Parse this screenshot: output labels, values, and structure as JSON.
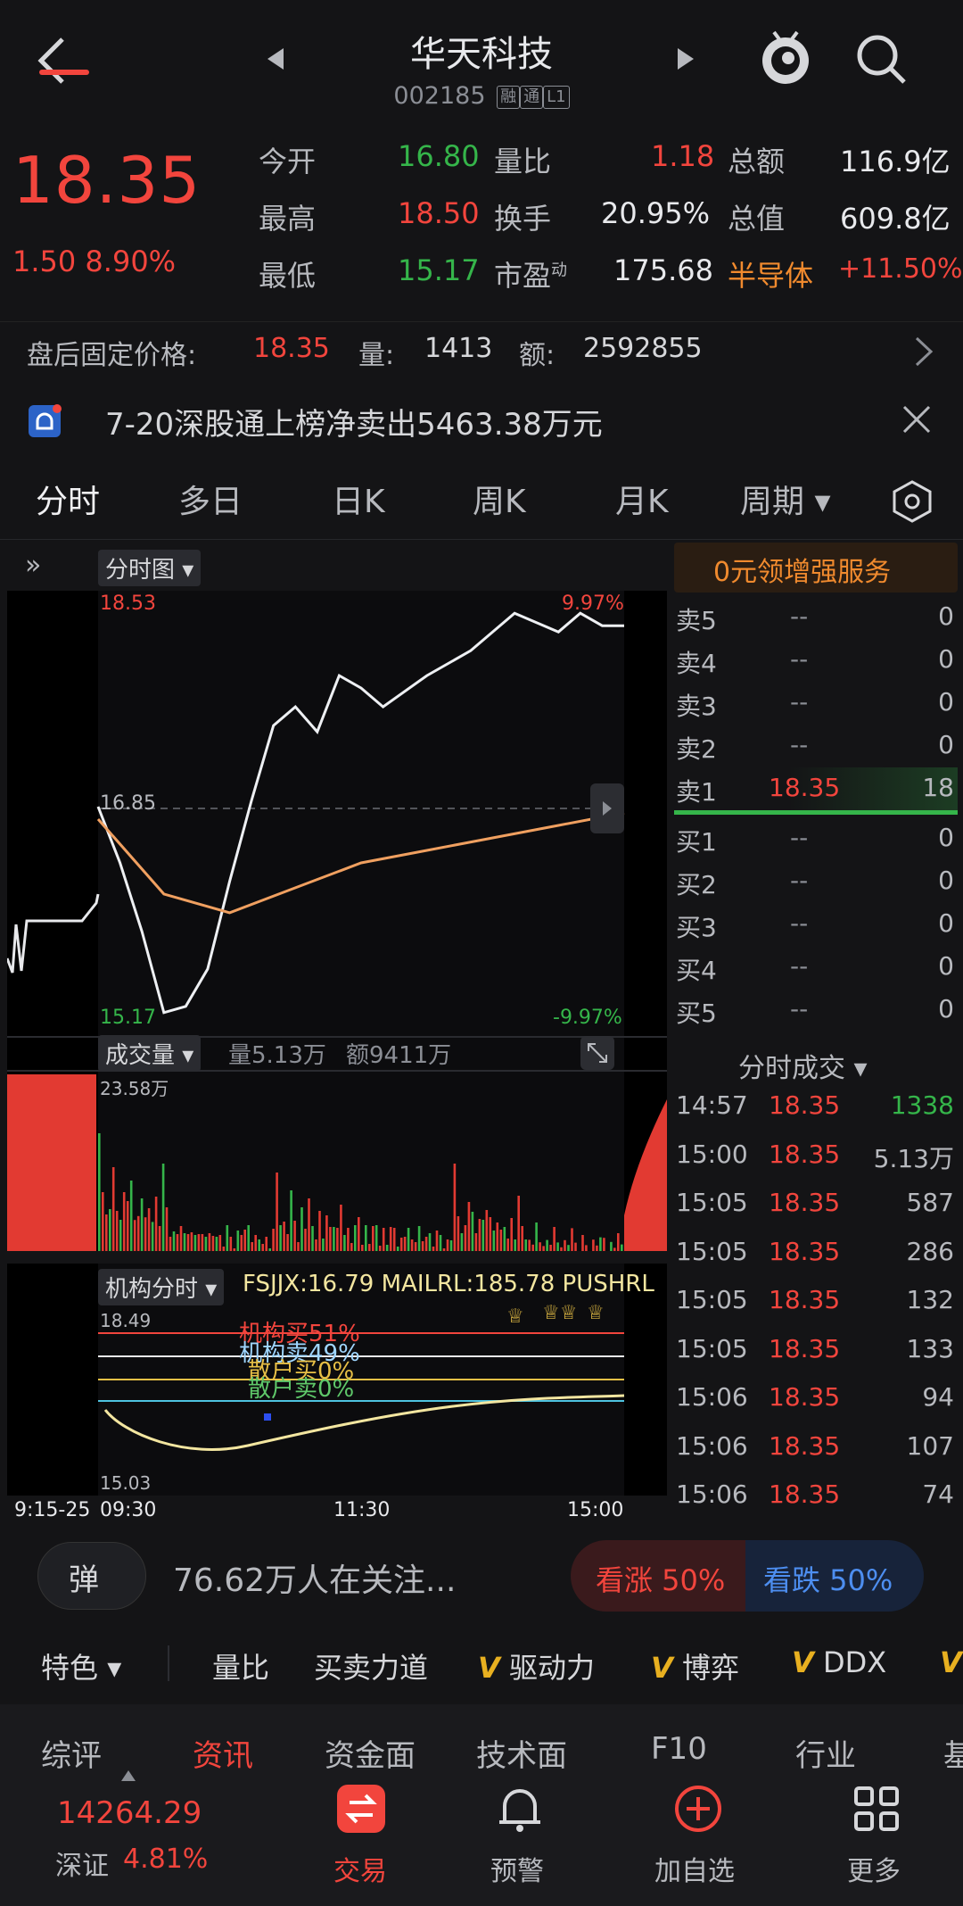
{
  "header": {
    "title": "华天科技",
    "code": "002185",
    "tags": [
      "融",
      "通",
      "L1"
    ]
  },
  "quote": {
    "price": "18.35",
    "change": "1.50",
    "change_pct": "8.90%",
    "rows": [
      {
        "l1": "今开",
        "v1": "16.80",
        "c1": "green",
        "l2": "量比",
        "v2": "1.18",
        "c2": "red",
        "l3": "总额",
        "v3": "116.9亿"
      },
      {
        "l1": "最高",
        "v1": "18.50",
        "c1": "red",
        "l2": "换手",
        "v2": "20.95%",
        "c2": "white",
        "l3": "总值",
        "v3": "609.8亿"
      },
      {
        "l1": "最低",
        "v1": "15.17",
        "c1": "green",
        "l2": "市盈",
        "sup": "动",
        "v2": "175.68",
        "c2": "white",
        "l3": "半导体",
        "v3": "+11.50%"
      }
    ]
  },
  "after_hours": {
    "label": "盘后固定价格:",
    "price": "18.35",
    "vol_label": "量:",
    "vol": "1413",
    "amt_label": "额:",
    "amt": "2592855"
  },
  "notice": {
    "text": "7-20深股通上榜净卖出5463.38万元"
  },
  "tabs": [
    "分时",
    "多日",
    "日K",
    "周K",
    "月K",
    "周期"
  ],
  "chart": {
    "selector": "分时图",
    "high_label": "18.53",
    "low_label": "15.17",
    "mid_label": "16.85",
    "up_pct": "9.97%",
    "down_pct": "-9.97%",
    "vol_selector": "成交量",
    "vol_text": "量5.13万",
    "amt_text": "额9411万",
    "vol_max": "23.58万",
    "inst_selector": "机构分时",
    "inst_info": "FSJJX:16.79 MAILRL:185.78 PUSHRL",
    "inst_high": "18.49",
    "inst_low": "15.03",
    "inst_buy": "机构买51%",
    "inst_sell": "机构卖49%",
    "retail_buy": "散户买0%",
    "retail_sell": "散户卖0%",
    "time_labels": [
      "9:15-25",
      "09:30",
      "11:30",
      "15:00"
    ]
  },
  "chart_data": {
    "type": "line",
    "title": "分时图",
    "series": [
      {
        "x": [
          "09:30",
          "09:40",
          "09:50",
          "10:00",
          "10:10",
          "10:20",
          "10:30",
          "10:40",
          "10:50",
          "11:00",
          "11:10",
          "11:20",
          "11:30",
          "13:10",
          "13:30",
          "13:50",
          "14:10",
          "14:30",
          "14:40",
          "14:50",
          "15:00"
        ],
        "values": [
          16.9,
          16.45,
          15.9,
          15.25,
          15.3,
          15.6,
          16.3,
          16.95,
          17.55,
          17.7,
          17.5,
          17.95,
          17.85,
          17.7,
          17.95,
          18.15,
          18.45,
          18.3,
          18.45,
          18.35,
          18.35
        ]
      },
      {
        "x": [
          "09:30",
          "10:00",
          "10:30",
          "11:00",
          "11:30",
          "13:30",
          "14:00",
          "14:30",
          "15:00"
        ],
        "values": [
          16.8,
          16.2,
          16.05,
          16.25,
          16.45,
          16.55,
          16.65,
          16.75,
          16.85
        ]
      }
    ],
    "ylim": [
      15.17,
      18.53
    ]
  },
  "order_book": {
    "asks": [
      {
        "label": "卖5",
        "price": "--",
        "vol": "0"
      },
      {
        "label": "卖4",
        "price": "--",
        "vol": "0"
      },
      {
        "label": "卖3",
        "price": "--",
        "vol": "0"
      },
      {
        "label": "卖2",
        "price": "--",
        "vol": "0"
      },
      {
        "label": "卖1",
        "price": "18.35",
        "vol": "18"
      }
    ],
    "bids": [
      {
        "label": "买1",
        "price": "--",
        "vol": "0"
      },
      {
        "label": "买2",
        "price": "--",
        "vol": "0"
      },
      {
        "label": "买3",
        "price": "--",
        "vol": "0"
      },
      {
        "label": "买4",
        "price": "--",
        "vol": "0"
      },
      {
        "label": "买5",
        "price": "--",
        "vol": "0"
      }
    ],
    "promo": "0元领增强服务"
  },
  "ticks": {
    "title": "分时成交",
    "rows": [
      {
        "t": "14:57",
        "p": "18.35",
        "v": "1338",
        "vc": "green"
      },
      {
        "t": "15:00",
        "p": "18.35",
        "v": "5.13万",
        "vc": "gray"
      },
      {
        "t": "15:05",
        "p": "18.35",
        "v": "587",
        "vc": "gray"
      },
      {
        "t": "15:05",
        "p": "18.35",
        "v": "286",
        "vc": "gray"
      },
      {
        "t": "15:05",
        "p": "18.35",
        "v": "132",
        "vc": "gray"
      },
      {
        "t": "15:05",
        "p": "18.35",
        "v": "133",
        "vc": "gray"
      },
      {
        "t": "15:06",
        "p": "18.35",
        "v": "94",
        "vc": "gray"
      },
      {
        "t": "15:06",
        "p": "18.35",
        "v": "107",
        "vc": "gray"
      },
      {
        "t": "15:06",
        "p": "18.35",
        "v": "74",
        "vc": "gray"
      }
    ]
  },
  "watch": {
    "danmu": "弹",
    "text": "76.62万人在关注...",
    "up": "看涨 50%",
    "down": "看跌 50%"
  },
  "features": [
    "特色",
    "量比",
    "买卖力道",
    "驱动力",
    "博弈",
    "DDX"
  ],
  "bottom_tabs": [
    "综评",
    "资讯",
    "资金面",
    "技术面",
    "F10",
    "行业",
    "基"
  ],
  "bottom_nav": {
    "index_value": "14264.29",
    "index_name": "深证",
    "index_pct": "4.81%",
    "items": [
      "交易",
      "预警",
      "加自选",
      "更多"
    ]
  }
}
